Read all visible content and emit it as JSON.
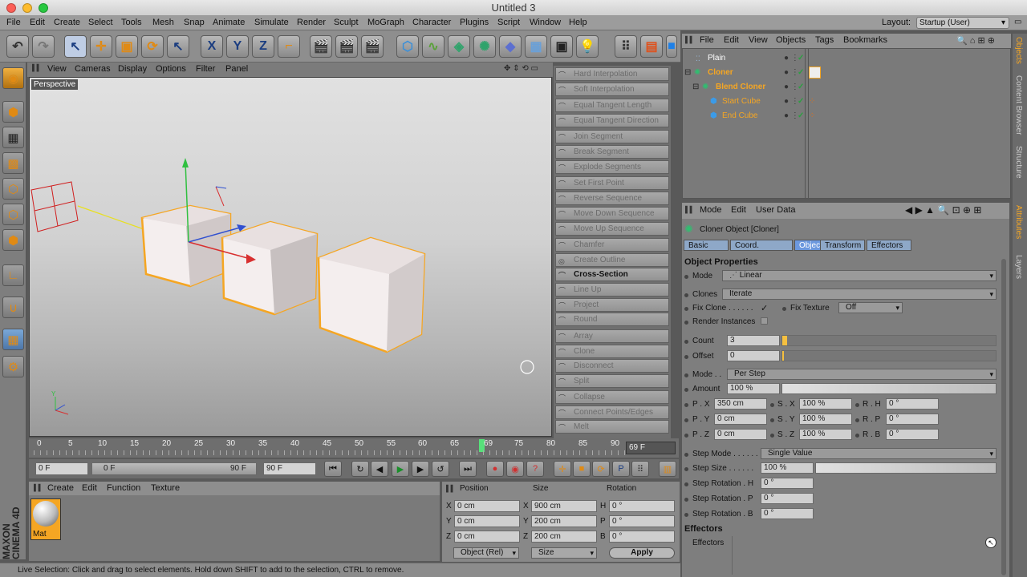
{
  "window": {
    "title": "Untitled 3"
  },
  "menubar": {
    "items": [
      "File",
      "Edit",
      "Create",
      "Select",
      "Tools",
      "Mesh",
      "Snap",
      "Animate",
      "Simulate",
      "Render",
      "Sculpt",
      "MoGraph",
      "Character",
      "Plugins",
      "Script",
      "Window",
      "Help"
    ],
    "layout_label": "Layout:",
    "layout_value": "Startup (User)"
  },
  "viewport": {
    "menu": [
      "View",
      "Cameras",
      "Display",
      "Options",
      "Filter",
      "Panel"
    ],
    "label": "Perspective"
  },
  "spline_commands": [
    {
      "label": "Hard Interpolation",
      "active": false
    },
    {
      "label": "Soft Interpolation",
      "active": false
    },
    {
      "label": "Equal Tangent Length",
      "active": false
    },
    {
      "label": "Equal Tangent Direction",
      "active": false
    },
    {
      "label": "Join Segment",
      "active": false
    },
    {
      "label": "Break Segment",
      "active": false
    },
    {
      "label": "Explode Segments",
      "active": false
    },
    {
      "label": "Set First Point",
      "active": false
    },
    {
      "label": "Reverse Sequence",
      "active": false
    },
    {
      "label": "Move Down Sequence",
      "active": false
    },
    {
      "label": "Move Up Sequence",
      "active": false
    },
    {
      "label": "Chamfer",
      "active": false
    },
    {
      "label": "Create Outline",
      "active": false
    },
    {
      "label": "Cross-Section",
      "active": true
    },
    {
      "label": "Line Up",
      "active": false
    },
    {
      "label": "Project",
      "active": false
    },
    {
      "label": "Round",
      "active": false
    },
    {
      "label": "Array",
      "active": false
    },
    {
      "label": "Clone",
      "active": false
    },
    {
      "label": "Disconnect",
      "active": false
    },
    {
      "label": "Split",
      "active": false
    },
    {
      "label": "Collapse",
      "active": false
    },
    {
      "label": "Connect Points/Edges",
      "active": false
    },
    {
      "label": "Melt",
      "active": false
    }
  ],
  "timeline": {
    "ticks": [
      "0",
      "5",
      "10",
      "15",
      "20",
      "25",
      "30",
      "35",
      "40",
      "45",
      "50",
      "55",
      "60",
      "65",
      "69",
      "75",
      "80",
      "85",
      "90"
    ],
    "current_frame": 69,
    "frame_field": "69 F"
  },
  "transport": {
    "start": "0 F",
    "range_start": "0 F",
    "range_end": "90 F",
    "end": "90 F"
  },
  "materials": {
    "menu": [
      "Create",
      "Edit",
      "Function",
      "Texture"
    ],
    "items": [
      {
        "name": "Mat"
      }
    ]
  },
  "coordinates": {
    "headers": [
      "Position",
      "Size",
      "Rotation"
    ],
    "rows": [
      {
        "axis": "X",
        "pos": "0 cm",
        "size_axis": "X",
        "size": "900 cm",
        "rot_axis": "H",
        "rot": "0 °"
      },
      {
        "axis": "Y",
        "pos": "0 cm",
        "size_axis": "Y",
        "size": "200 cm",
        "rot_axis": "P",
        "rot": "0 °"
      },
      {
        "axis": "Z",
        "pos": "0 cm",
        "size_axis": "Z",
        "size": "200 cm",
        "rot_axis": "B",
        "rot": "0 °"
      }
    ],
    "mode": "Object (Rel)",
    "size_mode": "Size",
    "apply": "Apply"
  },
  "status": "Live Selection: Click and drag to select elements. Hold down SHIFT to add to the selection, CTRL to remove.",
  "objects": {
    "menu": [
      "File",
      "Edit",
      "View",
      "Objects",
      "Tags",
      "Bookmarks"
    ],
    "items": [
      {
        "name": "Plain",
        "level": 0,
        "color": "#ffffff"
      },
      {
        "name": "Cloner",
        "level": 0,
        "color": "#f5a623"
      },
      {
        "name": "Blend Cloner",
        "level": 1,
        "color": "#f5a623"
      },
      {
        "name": "Start Cube",
        "level": 2,
        "color": "#f5a623"
      },
      {
        "name": "End Cube",
        "level": 2,
        "color": "#f5a623"
      }
    ]
  },
  "attributes": {
    "menu": [
      "Mode",
      "Edit",
      "User Data"
    ],
    "object_title": "Cloner Object [Cloner]",
    "tabs": [
      "Basic",
      "Coord.",
      "Object",
      "Transform",
      "Effectors"
    ],
    "section": "Object Properties",
    "mode_label": "Mode",
    "mode_value": "Linear",
    "clones_label": "Clones",
    "clones_value": "Iterate",
    "fix_clone": "Fix Clone . . . . . .",
    "fix_clone_check": "✓",
    "fix_texture": "Fix Texture",
    "fix_texture_value": "Off",
    "render_instances": "Render Instances",
    "count_label": "Count",
    "count_value": "3",
    "offset_label": "Offset",
    "offset_value": "0",
    "mode2_label": "Mode . .",
    "mode2_value": "Per Step",
    "amount_label": "Amount",
    "amount_value": "100 %",
    "px_label": "P . X",
    "px": "350 cm",
    "sx_label": "S . X",
    "sx": "100 %",
    "rh_label": "R . H",
    "rh": "0 °",
    "py_label": "P . Y",
    "py": "0 cm",
    "sy_label": "S . Y",
    "sy": "100 %",
    "rp_label": "R . P",
    "rp": "0 °",
    "pz_label": "P . Z",
    "pz": "0 cm",
    "sz_label": "S . Z",
    "sz": "100 %",
    "rb_label": "R . B",
    "rb": "0 °",
    "step_mode_label": "Step Mode . . . . . .",
    "step_mode_value": "Single Value",
    "step_size_label": "Step Size . . . . . .",
    "step_size_value": "100 %",
    "step_rot_h_label": "Step Rotation . H",
    "step_rot_h": "0 °",
    "step_rot_p_label": "Step Rotation . P",
    "step_rot_p": "0 °",
    "step_rot_b_label": "Step Rotation . B",
    "step_rot_b": "0 °",
    "effectors_section": "Effectors",
    "effectors_label": "Effectors"
  },
  "right_tabs": [
    "Objects",
    "Content Browser",
    "Structure",
    "Attributes",
    "Layers"
  ],
  "brand": "MAXON CINEMA 4D",
  "colors": {
    "accent_orange": "#f5a623",
    "selection_blue": "#8ea8c8",
    "active_tab": "#7a9fd6"
  }
}
